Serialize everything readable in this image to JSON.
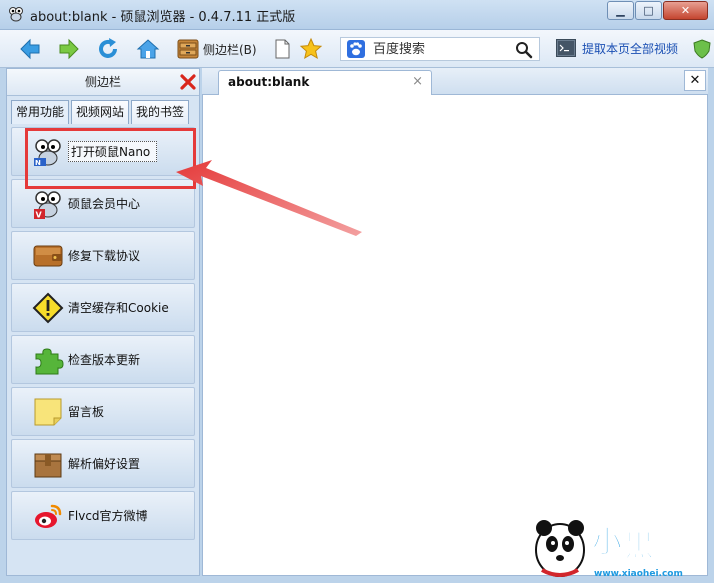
{
  "window": {
    "title": "about:blank - 硕鼠浏览器 - 0.4.7.11 正式版",
    "min_label": "▁",
    "max_label": "□",
    "close_label": "✕"
  },
  "toolbar": {
    "sidebar_label": "侧边栏(B)",
    "search_placeholder": "百度搜索",
    "extract_label": "提取本页全部视频"
  },
  "sidebar": {
    "title": "侧边栏",
    "tabs": [
      {
        "label": "常用功能"
      },
      {
        "label": "视频网站"
      },
      {
        "label": "我的书签"
      }
    ],
    "items": [
      {
        "label": "打开硕鼠Nano",
        "icon": "nano-mouse-icon"
      },
      {
        "label": "硕鼠会员中心",
        "icon": "vip-mouse-icon"
      },
      {
        "label": "修复下载协议",
        "icon": "wallet-icon"
      },
      {
        "label": "清空缓存和Cookie",
        "icon": "warning-icon"
      },
      {
        "label": "检查版本更新",
        "icon": "puzzle-icon"
      },
      {
        "label": "留言板",
        "icon": "sticky-note-icon"
      },
      {
        "label": "解析偏好设置",
        "icon": "box-icon"
      },
      {
        "label": "Flvcd官方微博",
        "icon": "weibo-icon"
      }
    ]
  },
  "tabs": [
    {
      "label": "about:blank",
      "close": "×"
    }
  ],
  "tabstrip_close": "✕",
  "colors": {
    "highlight": "#e53a3a",
    "link": "#1a4fb3"
  }
}
